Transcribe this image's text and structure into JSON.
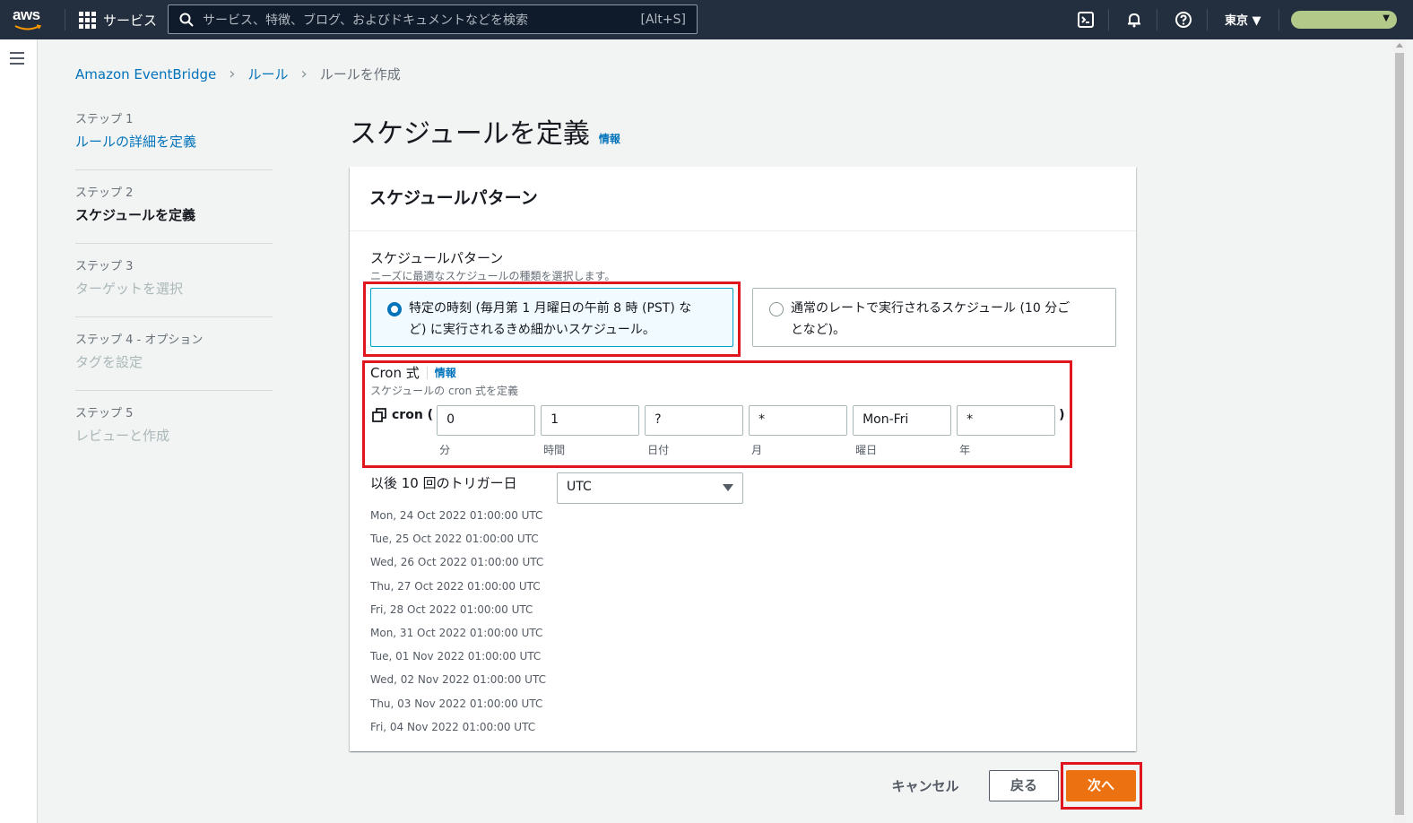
{
  "topnav": {
    "logo_text": "aws",
    "services_label": "サービス",
    "search_placeholder": "サービス、特徴、ブログ、およびドキュメントなどを検索",
    "search_shortcut": "[Alt+S]",
    "region": "東京 ▼",
    "account_caret": "▼",
    "icons": [
      "cloudshell-icon",
      "bell-icon",
      "help-icon"
    ]
  },
  "breadcrumb": {
    "items": [
      "Amazon EventBridge",
      "ルール"
    ],
    "current": "ルールを作成"
  },
  "steps": [
    {
      "number": "ステップ 1",
      "name": "ルールの詳細を定義",
      "state": "link"
    },
    {
      "number": "ステップ 2",
      "name": "スケジュールを定義",
      "state": "active"
    },
    {
      "number": "ステップ 3",
      "name": "ターゲットを選択",
      "state": "disabled"
    },
    {
      "number": "ステップ 4 - オプション",
      "name": "タグを設定",
      "state": "disabled"
    },
    {
      "number": "ステップ 5",
      "name": "レビューと作成",
      "state": "disabled"
    }
  ],
  "page": {
    "title": "スケジュールを定義",
    "info": "情報"
  },
  "panel": {
    "header": "スケジュールパターン",
    "pattern_label": "スケジュールパターン",
    "pattern_desc": "ニーズに最適なスケジュールの種類を選択します。",
    "option_fine_line1": "特定の時刻 (毎月第 1 月曜日の午前 8 時 (PST) な",
    "option_fine_line2": "ど) に実行されるきめ細かいスケジュール。",
    "option_rate_line1": "通常のレートで実行されるスケジュール (10 分ご",
    "option_rate_line2": "となど)。",
    "selected_option": "fine-grained",
    "cron_label": "Cron 式",
    "cron_info": "情報",
    "cron_desc": "スケジュールの cron 式を定義",
    "cron_prefix": "cron (",
    "cron_suffix": ")",
    "cron_fields": [
      {
        "value": "0",
        "label": "分"
      },
      {
        "value": "1",
        "label": "時間"
      },
      {
        "value": "?",
        "label": "日付"
      },
      {
        "value": "*",
        "label": "月"
      },
      {
        "value": "Mon-Fri",
        "label": "曜日"
      },
      {
        "value": "*",
        "label": "年"
      }
    ],
    "trigger_label": "以後 10 回のトリガー日",
    "timezone": "UTC",
    "trigger_dates": [
      "Mon, 24 Oct 2022 01:00:00 UTC",
      "Tue, 25 Oct 2022 01:00:00 UTC",
      "Wed, 26 Oct 2022 01:00:00 UTC",
      "Thu, 27 Oct 2022 01:00:00 UTC",
      "Fri, 28 Oct 2022 01:00:00 UTC",
      "Mon, 31 Oct 2022 01:00:00 UTC",
      "Tue, 01 Nov 2022 01:00:00 UTC",
      "Wed, 02 Nov 2022 01:00:00 UTC",
      "Thu, 03 Nov 2022 01:00:00 UTC",
      "Fri, 04 Nov 2022 01:00:00 UTC"
    ]
  },
  "footer": {
    "cancel": "キャンセル",
    "back": "戻る",
    "next": "次へ"
  },
  "colors": {
    "nav_bg": "#232f3e",
    "link": "#0073bb",
    "primary_button": "#ec7211",
    "highlight_box": "#e0161e"
  }
}
